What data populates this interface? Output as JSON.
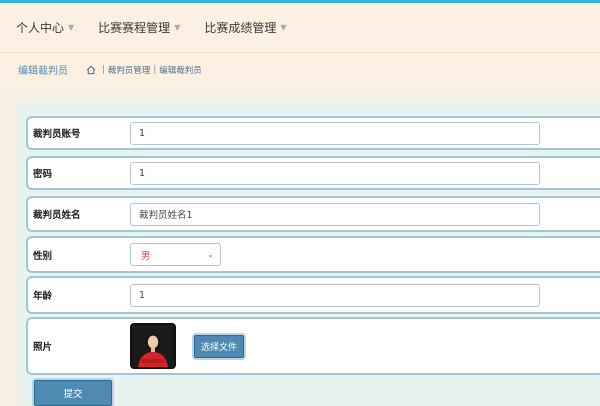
{
  "nav": {
    "items": [
      {
        "label": "个人中心"
      },
      {
        "label": "比赛赛程管理"
      },
      {
        "label": "比赛成绩管理"
      }
    ]
  },
  "subbar": {
    "page_title": "编辑裁判员",
    "breadcrumb": [
      "裁判员管理",
      "编辑裁判员"
    ]
  },
  "form": {
    "account": {
      "label": "裁判员账号",
      "value": "1"
    },
    "password": {
      "label": "密码",
      "value": "1"
    },
    "name": {
      "label": "裁判员姓名",
      "value": "裁判员姓名1"
    },
    "gender": {
      "label": "性别",
      "value": "男"
    },
    "age": {
      "label": "年龄",
      "value": "1"
    },
    "photo": {
      "label": "照片",
      "button": "选择文件"
    },
    "submit": "提交"
  },
  "colors": {
    "accent": "#4f8ab2",
    "top_border": "#37b5d9",
    "header_bg": "#fbf0e2",
    "content_bg": "#e9f3ee",
    "row_border": "#9fc7d8",
    "select_text": "#e04a4a"
  },
  "icons": {
    "home": "home-icon",
    "caret": "caret-down-icon"
  }
}
